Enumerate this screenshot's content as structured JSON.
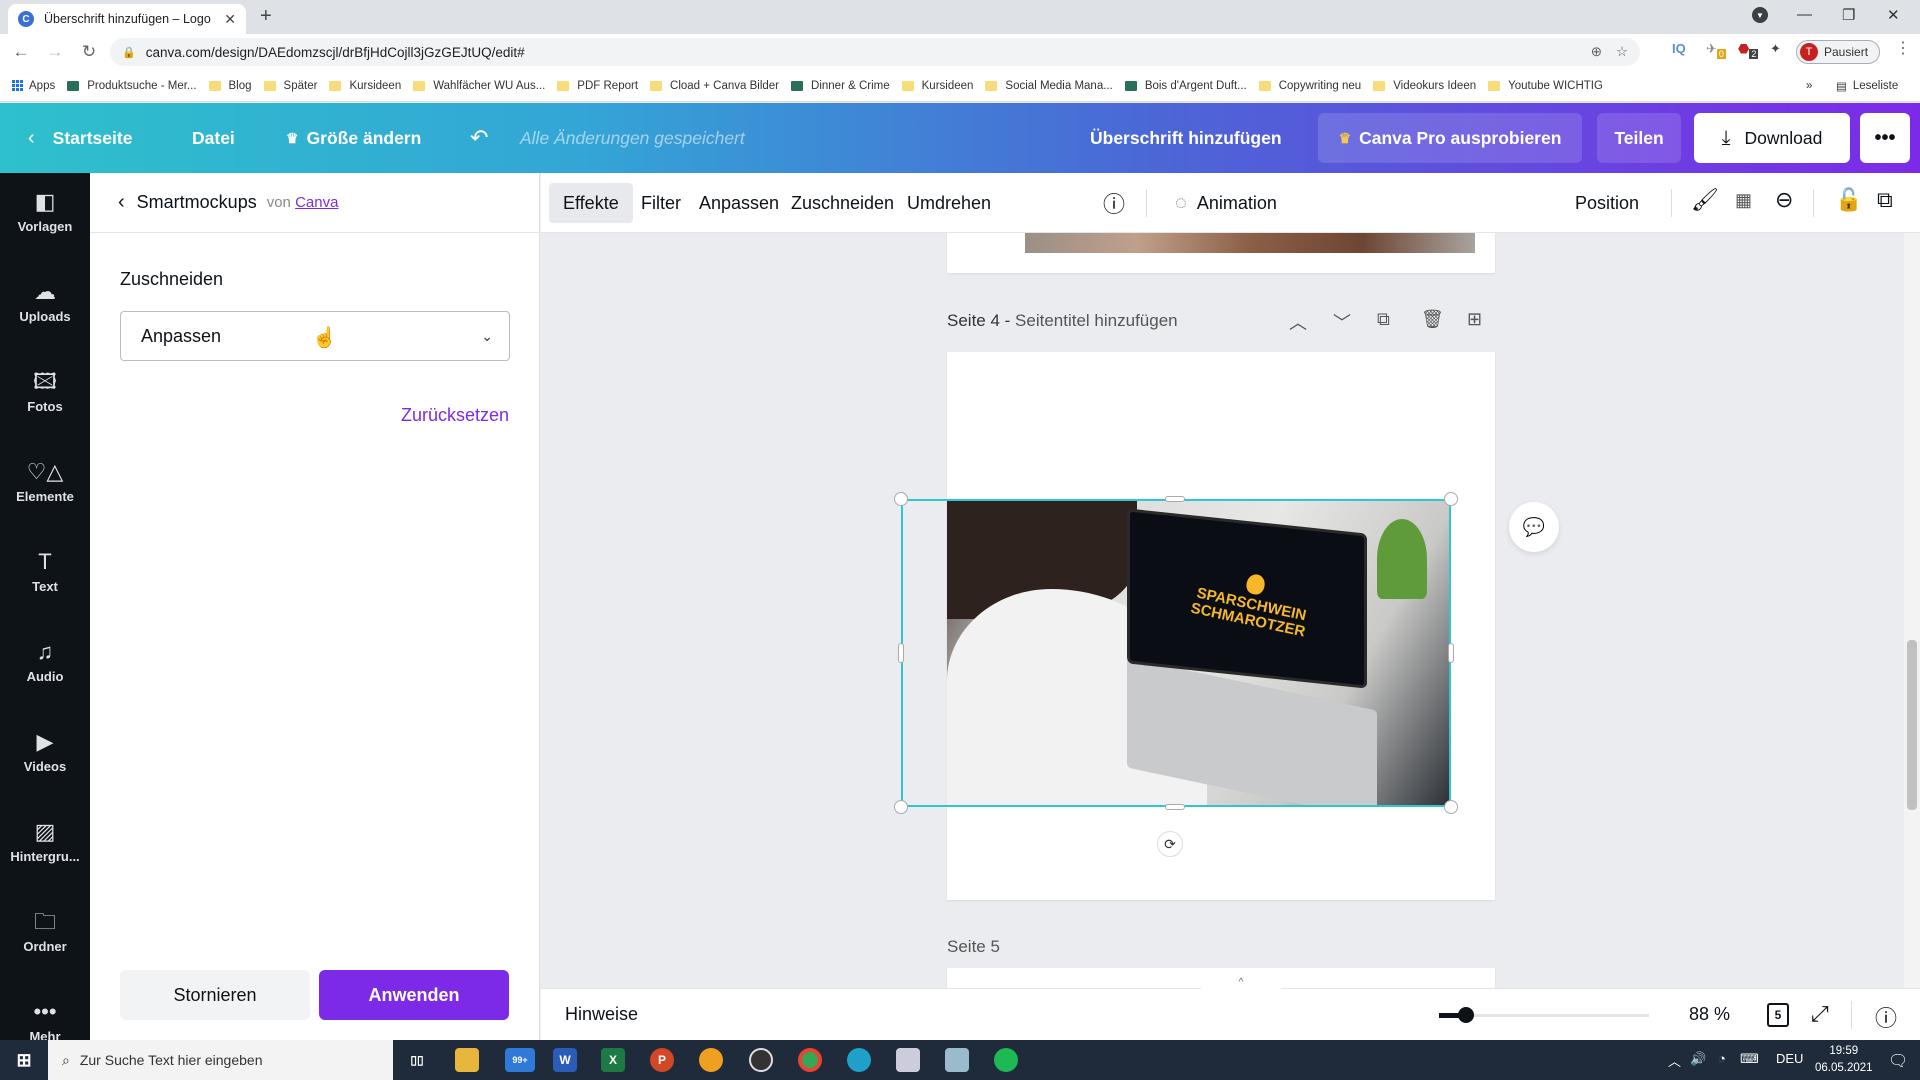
{
  "browser": {
    "tab_title": "Überschrift hinzufügen – Logo",
    "tab_favicon": "C",
    "new_tab": "+",
    "url": "canva.com/design/DAEdomzscjl/drBfjHdCojll3jGzGEJtUQ/edit#",
    "profile_initial": "T",
    "profile_status": "Pausiert",
    "ext_iq": "IQ",
    "ext_badge_1": "0",
    "ext_badge_2": "2",
    "window_controls": {
      "minimize": "—",
      "restore": "❐",
      "close": "✕"
    }
  },
  "bookmarks": [
    {
      "label": "Apps",
      "type": "apps"
    },
    {
      "label": "Produktsuche - Mer...",
      "type": "site"
    },
    {
      "label": "Blog",
      "type": "folder"
    },
    {
      "label": "Später",
      "type": "folder"
    },
    {
      "label": "Kursideen",
      "type": "folder"
    },
    {
      "label": "Wahlfächer WU Aus...",
      "type": "folder"
    },
    {
      "label": "PDF Report",
      "type": "folder"
    },
    {
      "label": "Cload + Canva Bilder",
      "type": "folder"
    },
    {
      "label": "Dinner & Crime",
      "type": "site"
    },
    {
      "label": "Kursideen",
      "type": "folder"
    },
    {
      "label": "Social Media Mana...",
      "type": "folder"
    },
    {
      "label": "Bois d'Argent Duft...",
      "type": "site"
    },
    {
      "label": "Copywriting neu",
      "type": "folder"
    },
    {
      "label": "Videokurs Ideen",
      "type": "folder"
    },
    {
      "label": "Youtube WICHTIG",
      "type": "folder"
    }
  ],
  "bookmarks_more": "»",
  "reading_list": "Leseliste",
  "header": {
    "home": "Startseite",
    "file": "Datei",
    "resize": "Größe ändern",
    "saved_status": "Alle Änderungen gespeichert",
    "design_title": "Überschrift hinzufügen",
    "try_pro": "Canva Pro ausprobieren",
    "share": "Teilen",
    "download": "Download",
    "more": "•••"
  },
  "rail": [
    {
      "label": "Vorlagen",
      "icon": "templates-icon",
      "glyph": "◧"
    },
    {
      "label": "Uploads",
      "icon": "upload-cloud-icon",
      "glyph": "☁"
    },
    {
      "label": "Fotos",
      "icon": "photo-icon",
      "glyph": "🖾"
    },
    {
      "label": "Elemente",
      "icon": "elements-icon",
      "glyph": "♡△"
    },
    {
      "label": "Text",
      "icon": "text-icon",
      "glyph": "T"
    },
    {
      "label": "Audio",
      "icon": "music-note-icon",
      "glyph": "♫"
    },
    {
      "label": "Videos",
      "icon": "video-icon",
      "glyph": "▶"
    },
    {
      "label": "Hintergru...",
      "icon": "background-icon",
      "glyph": "▨"
    },
    {
      "label": "Ordner",
      "icon": "folder-icon",
      "glyph": "🗀"
    },
    {
      "label": "Mehr",
      "icon": "more-icon",
      "glyph": "•••"
    }
  ],
  "panel": {
    "title": "Smartmockups",
    "by": "von",
    "by_link": "Canva",
    "section": "Zuschneiden",
    "select_value": "Anpassen",
    "reset": "Zurücksetzen",
    "cancel": "Stornieren",
    "apply": "Anwenden"
  },
  "toolbar": {
    "items": [
      "Effekte",
      "Filter",
      "Anpassen",
      "Zuschneiden",
      "Umdrehen"
    ],
    "active": "Effekte",
    "animation": "Animation",
    "position": "Position"
  },
  "canvas": {
    "page4_label": "Seite 4 -",
    "page4_placeholder": "Seitentitel hinzufügen",
    "page5_label": "Seite 5",
    "mockup_text_line1": "SPARSCHWEIN",
    "mockup_text_line2": "SCHMAROTZER"
  },
  "bottom": {
    "notes": "Hinweise",
    "zoom_percent": 88,
    "zoom_label": "88 %",
    "zoom_slider_fraction": 0.13,
    "page_count": "5"
  },
  "taskbar": {
    "search_placeholder": "Zur Suche Text hier eingeben",
    "mail_badge": "99+",
    "language": "DEU",
    "time": "19:59",
    "date": "06.05.2021"
  }
}
